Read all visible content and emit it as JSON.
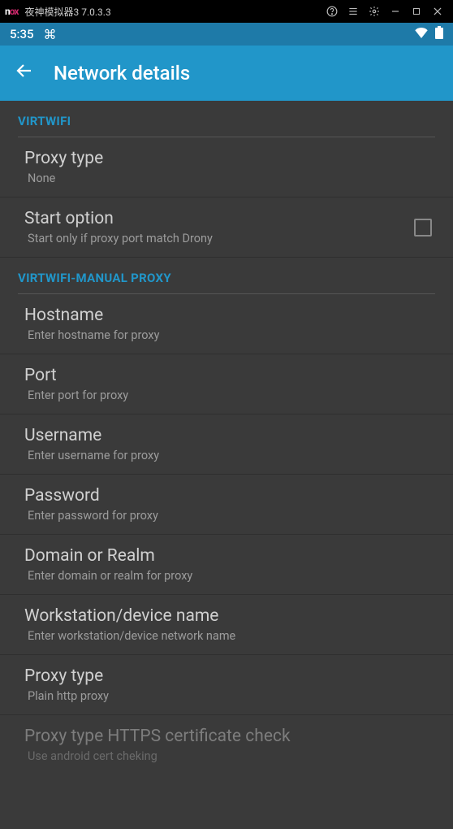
{
  "emulator": {
    "logo_plain": "n",
    "logo_red": "ox",
    "title": "夜神模拟器3 7.0.3.3"
  },
  "statusbar": {
    "time": "5:35"
  },
  "appbar": {
    "title": "Network details"
  },
  "section1": {
    "header": "VIRTWIFI"
  },
  "proxy_type1": {
    "label": "Proxy type",
    "sub": "None"
  },
  "start_option": {
    "label": "Start option",
    "sub": "Start only if proxy port match Drony"
  },
  "section2": {
    "header": "VIRTWIFI-MANUAL PROXY"
  },
  "hostname": {
    "label": "Hostname",
    "sub": "Enter hostname for proxy"
  },
  "port": {
    "label": "Port",
    "sub": "Enter port for proxy"
  },
  "username": {
    "label": "Username",
    "sub": "Enter username for proxy"
  },
  "password": {
    "label": "Password",
    "sub": "Enter password for proxy"
  },
  "domain": {
    "label": "Domain or Realm",
    "sub": "Enter domain or realm for proxy"
  },
  "workstation": {
    "label": "Workstation/device name",
    "sub": "Enter workstation/device network name"
  },
  "proxy_type2": {
    "label": "Proxy type",
    "sub": "Plain http proxy"
  },
  "https_check": {
    "label": "Proxy type HTTPS certificate check",
    "sub": "Use android cert cheking"
  }
}
